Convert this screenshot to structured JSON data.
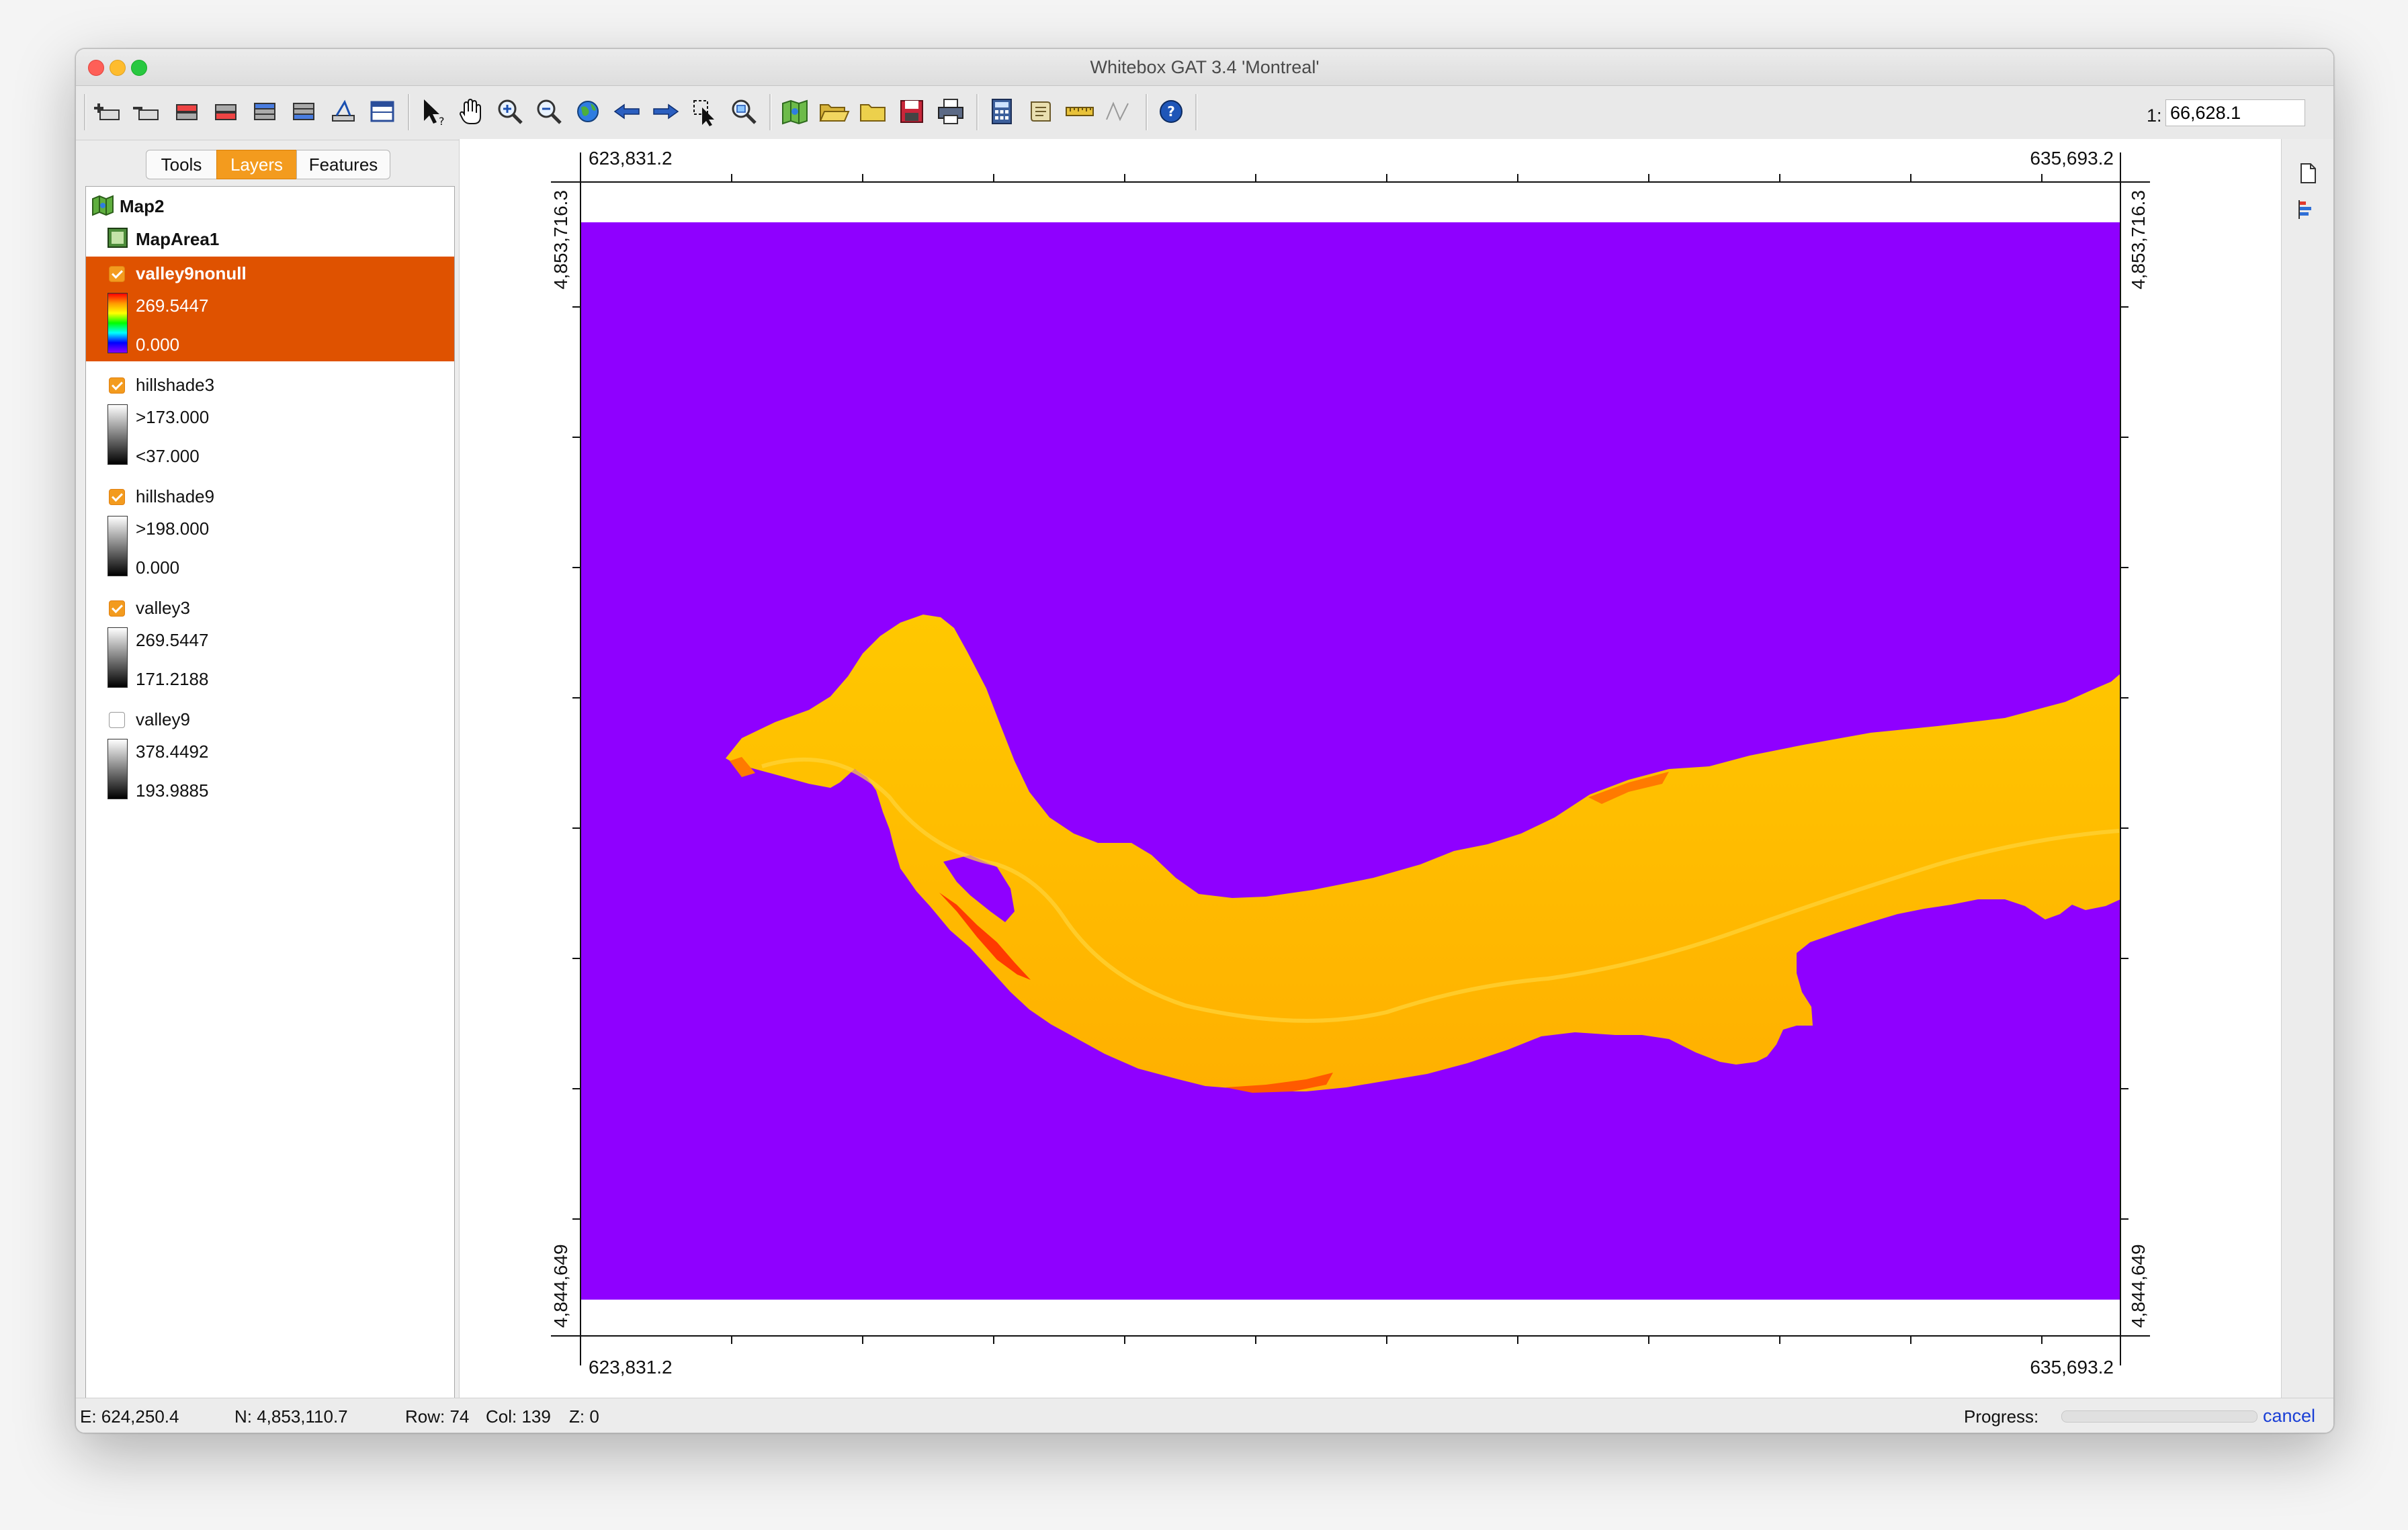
{
  "window": {
    "title": "Whitebox GAT 3.4 'Montreal'"
  },
  "toolbar": {
    "scale_prefix": "1:",
    "scale_value": "66,628.1",
    "buttons": [
      {
        "name": "add-layer-button",
        "icon": "add-layer-icon"
      },
      {
        "name": "remove-layer-button",
        "icon": "remove-layer-icon"
      },
      {
        "name": "raise-layer-button",
        "icon": "raise-layer-icon"
      },
      {
        "name": "lower-layer-button",
        "icon": "lower-layer-icon"
      },
      {
        "name": "layer-to-top-button",
        "icon": "layer-top-icon"
      },
      {
        "name": "layer-to-bottom-button",
        "icon": "layer-bottom-icon"
      },
      {
        "name": "layer-properties-button",
        "icon": "layer-properties-icon"
      },
      {
        "name": "attribute-table-button",
        "icon": "table-icon"
      },
      {
        "name": "select-button",
        "icon": "cursor-question-icon"
      },
      {
        "name": "pan-button",
        "icon": "hand-icon"
      },
      {
        "name": "zoom-in-button",
        "icon": "zoom-in-icon"
      },
      {
        "name": "zoom-out-button",
        "icon": "zoom-out-icon"
      },
      {
        "name": "full-extent-button",
        "icon": "globe-icon"
      },
      {
        "name": "previous-extent-button",
        "icon": "arrow-left-icon"
      },
      {
        "name": "next-extent-button",
        "icon": "arrow-right-icon"
      },
      {
        "name": "zoom-to-selection-button",
        "icon": "zoom-select-icon"
      },
      {
        "name": "zoom-to-layer-button",
        "icon": "zoom-layer-icon"
      },
      {
        "name": "new-map-button",
        "icon": "map-icon"
      },
      {
        "name": "open-map-button",
        "icon": "open-folder-icon"
      },
      {
        "name": "folder-button",
        "icon": "folder-icon"
      },
      {
        "name": "save-map-button",
        "icon": "save-icon"
      },
      {
        "name": "print-map-button",
        "icon": "print-icon"
      },
      {
        "name": "calculator-button",
        "icon": "calculator-icon"
      },
      {
        "name": "scripting-button",
        "icon": "scroll-icon"
      },
      {
        "name": "measure-button",
        "icon": "ruler-icon"
      },
      {
        "name": "digitize-button",
        "icon": "polyline-icon"
      },
      {
        "name": "help-button",
        "icon": "help-icon"
      }
    ]
  },
  "sidebar": {
    "tabs": [
      {
        "label": "Tools",
        "active": false
      },
      {
        "label": "Layers",
        "active": true
      },
      {
        "label": "Features",
        "active": false
      }
    ],
    "map_name": "Map2",
    "map_area": "MapArea1",
    "layers": [
      {
        "name": "valley9nonull",
        "checked": true,
        "selected": true,
        "max": "269.5447",
        "min": "0.000",
        "palette": "spectrum"
      },
      {
        "name": "hillshade3",
        "checked": true,
        "selected": false,
        "max": ">173.000",
        "min": "<37.000",
        "palette": "grey"
      },
      {
        "name": "hillshade9",
        "checked": true,
        "selected": false,
        "max": ">198.000",
        "min": "0.000",
        "palette": "grey"
      },
      {
        "name": "valley3",
        "checked": true,
        "selected": false,
        "max": "269.5447",
        "min": "171.2188",
        "palette": "grey"
      },
      {
        "name": "valley9",
        "checked": false,
        "selected": false,
        "max": "378.4492",
        "min": "193.9885",
        "palette": "grey"
      }
    ]
  },
  "map": {
    "x_min": "623,831.2",
    "x_max": "635,693.2",
    "y_max": "4,853,716.3",
    "y_min": "4,844,649",
    "nodata_color": "#8f00ff",
    "valley_color": "#ffc400"
  },
  "status": {
    "easting": "E: 624,250.4",
    "northing": "N: 4,853,110.7",
    "row": "Row: 74",
    "col": "Col: 139",
    "z": "Z: 0",
    "progress_label": "Progress:",
    "progress_value": 0,
    "cancel": "cancel"
  }
}
